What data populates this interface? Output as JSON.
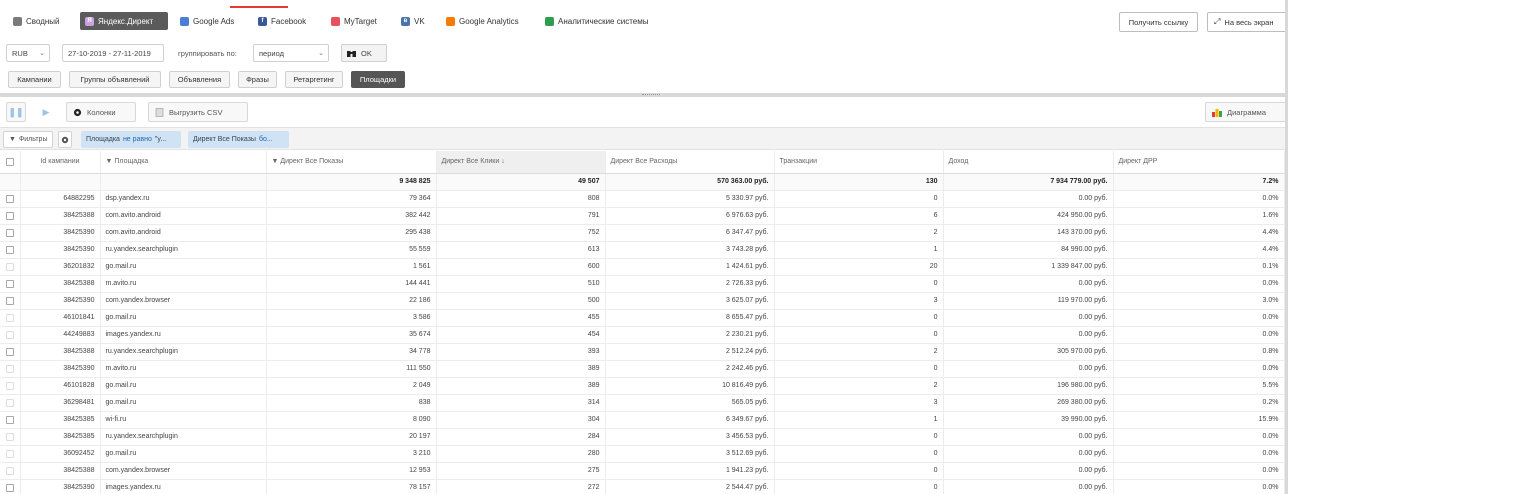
{
  "sources": [
    {
      "label": "Сводный",
      "icon": "chart-bars-icon",
      "color": "#7a7a7a",
      "active": false
    },
    {
      "label": "Яндекс.Директ",
      "icon": "yandex-direct-icon",
      "color": "#9b59b6",
      "active": true
    },
    {
      "label": "Google Ads",
      "icon": "google-ads-icon",
      "color": "#4a7fd4",
      "active": false
    },
    {
      "label": "Facebook",
      "icon": "facebook-icon",
      "color": "#3b5998",
      "active": false
    },
    {
      "label": "MyTarget",
      "icon": "mytarget-icon",
      "color": "#e8505b",
      "active": false
    },
    {
      "label": "VK",
      "icon": "vk-icon",
      "color": "#4a76a8",
      "active": false
    },
    {
      "label": "Google Analytics",
      "icon": "google-analytics-icon",
      "color": "#f57c00",
      "active": false
    },
    {
      "label": "Аналитические системы",
      "icon": "analytics-systems-icon",
      "color": "#2e9d4f",
      "active": false
    }
  ],
  "top_actions": {
    "get_link": "Получить ссылку",
    "fullscreen": "На весь экран"
  },
  "filters": {
    "currency": "RUB",
    "date_range": "27-10-2019 - 27-11-2019",
    "group_by_label": "группировать по:",
    "group_by_value": "период",
    "ok_label": "OK"
  },
  "levels": [
    {
      "label": "Кампании",
      "active": false
    },
    {
      "label": "Группы объявлений",
      "active": false
    },
    {
      "label": "Объявления",
      "active": false
    },
    {
      "label": "Фразы",
      "active": false
    },
    {
      "label": "Ретаргетинг",
      "active": false
    },
    {
      "label": "Площадки",
      "active": true
    }
  ],
  "toolbar": {
    "columns_label": "Колонки",
    "export_label": "Выгрузить CSV",
    "chart_label": "Диаграмма"
  },
  "filter_chips": {
    "filters_label": "Фильтры",
    "chip1_prefix": "Площадка",
    "chip1_op": "не равно",
    "chip1_value": "\"y...",
    "chip2_prefix": "Директ Все Показы",
    "chip2_op": "бо..."
  },
  "table": {
    "columns": [
      "Id кампании",
      "Площадка",
      "Директ Все Показы",
      "Директ Все Клики ↓",
      "Директ Все Расходы",
      "Транзакции",
      "Доход",
      "Директ ДРР"
    ],
    "totals": [
      "",
      "",
      "9 348 825",
      "49 507",
      "570 363.00 руб.",
      "130",
      "7 934 779.00 руб.",
      "7.2%"
    ],
    "rows": [
      [
        "64882295",
        "dsp.yandex.ru",
        "79 364",
        "808",
        "5 330.97 руб.",
        "0",
        "0.00 руб.",
        "0.0%"
      ],
      [
        "38425388",
        "com.avito.android",
        "382 442",
        "791",
        "6 976.63 руб.",
        "6",
        "424 950.00 руб.",
        "1.6%"
      ],
      [
        "38425390",
        "com.avito.android",
        "295 438",
        "752",
        "6 347.47 руб.",
        "2",
        "143 370.00 руб.",
        "4.4%"
      ],
      [
        "38425390",
        "ru.yandex.searchplugin",
        "55 559",
        "613",
        "3 743.28 руб.",
        "1",
        "84 990.00 руб.",
        "4.4%"
      ],
      [
        "36201832",
        "go.mail.ru",
        "1 561",
        "600",
        "1 424.61 руб.",
        "20",
        "1 339 847.00 руб.",
        "0.1%"
      ],
      [
        "38425388",
        "m.avito.ru",
        "144 441",
        "510",
        "2 726.33 руб.",
        "0",
        "0.00 руб.",
        "0.0%"
      ],
      [
        "38425390",
        "com.yandex.browser",
        "22 186",
        "500",
        "3 625.07 руб.",
        "3",
        "119 970.00 руб.",
        "3.0%"
      ],
      [
        "46101841",
        "go.mail.ru",
        "3 586",
        "455",
        "8 655.47 руб.",
        "0",
        "0.00 руб.",
        "0.0%"
      ],
      [
        "44249883",
        "images.yandex.ru",
        "35 674",
        "454",
        "2 230.21 руб.",
        "0",
        "0.00 руб.",
        "0.0%"
      ],
      [
        "38425388",
        "ru.yandex.searchplugin",
        "34 778",
        "393",
        "2 512.24 руб.",
        "2",
        "305 970.00 руб.",
        "0.8%"
      ],
      [
        "38425390",
        "m.avito.ru",
        "111 550",
        "389",
        "2 242.46 руб.",
        "0",
        "0.00 руб.",
        "0.0%"
      ],
      [
        "46101828",
        "go.mail.ru",
        "2 049",
        "389",
        "10 816.49 руб.",
        "2",
        "196 980.00 руб.",
        "5.5%"
      ],
      [
        "36298481",
        "go.mail.ru",
        "838",
        "314",
        "565.05 руб.",
        "3",
        "269 380.00 руб.",
        "0.2%"
      ],
      [
        "38425385",
        "wi-fi.ru",
        "8 090",
        "304",
        "6 349.67 руб.",
        "1",
        "39 990.00 руб.",
        "15.9%"
      ],
      [
        "38425385",
        "ru.yandex.searchplugin",
        "20 197",
        "284",
        "3 456.53 руб.",
        "0",
        "0.00 руб.",
        "0.0%"
      ],
      [
        "36092452",
        "go.mail.ru",
        "3 210",
        "280",
        "3 512.69 руб.",
        "0",
        "0.00 руб.",
        "0.0%"
      ],
      [
        "38425388",
        "com.yandex.browser",
        "12 953",
        "275",
        "1 941.23 руб.",
        "0",
        "0.00 руб.",
        "0.0%"
      ],
      [
        "38425390",
        "images.yandex.ru",
        "78 157",
        "272",
        "2 544.47 руб.",
        "0",
        "0.00 руб.",
        "0.0%"
      ]
    ]
  }
}
